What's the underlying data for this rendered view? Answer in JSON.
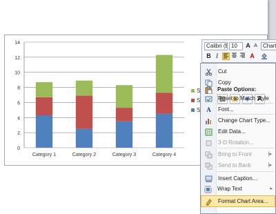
{
  "chart_data": {
    "type": "bar",
    "stacked": true,
    "categories": [
      "Category 1",
      "Category 2",
      "Category 3",
      "Category 4"
    ],
    "series": [
      {
        "name": "Seri",
        "values": [
          4.3,
          2.5,
          3.5,
          4.5
        ],
        "color": "#4f81bd"
      },
      {
        "name": "Seri",
        "values": [
          2.4,
          4.4,
          1.8,
          2.8
        ],
        "color": "#c0504d"
      },
      {
        "name": "Seri",
        "values": [
          2.0,
          2.0,
          3.0,
          5.0
        ],
        "color": "#9bbb59"
      }
    ],
    "ylim": [
      0,
      14
    ],
    "yticks": [
      "0",
      "2",
      "4",
      "6",
      "8",
      "10",
      "12",
      "14"
    ],
    "grid": true,
    "legend_position": "right",
    "legend_labels": [
      "Seri",
      "Seri",
      "Seri"
    ]
  },
  "minibar": {
    "font_name": "Calibri (E",
    "font_size": "10",
    "grow_font": "A",
    "shrink_font": "A",
    "chart_label": "Chart",
    "bold": "B",
    "italic": "I",
    "font_color": "A",
    "icons": [
      "align-left-icon",
      "align-center-icon",
      "align-right-icon",
      "font-color-icon",
      "fill-color-icon"
    ]
  },
  "context_menu": {
    "paste_options_label": "Paste Options:",
    "items": [
      {
        "label": "Cut",
        "icon": "cut-icon",
        "enabled": true
      },
      {
        "label": "Copy",
        "icon": "copy-icon",
        "enabled": true
      },
      {
        "label": "Reset to Match Style",
        "icon": "reset-style-icon",
        "enabled": true
      },
      {
        "label": "Font...",
        "icon": "font-icon",
        "enabled": true
      },
      {
        "label": "Change Chart Type...",
        "icon": "chart-type-icon",
        "enabled": true
      },
      {
        "label": "Edit Data...",
        "icon": "edit-data-icon",
        "enabled": true
      },
      {
        "label": "3-D Rotation...",
        "icon": "rotation-icon",
        "enabled": false
      },
      {
        "label": "Bring to Front",
        "icon": "bring-front-icon",
        "enabled": false
      },
      {
        "label": "Send to Back",
        "icon": "send-back-icon",
        "enabled": false
      },
      {
        "label": "Insert Caption...",
        "icon": "caption-icon",
        "enabled": true
      },
      {
        "label": "Wrap Text",
        "icon": "wrap-text-icon",
        "enabled": true
      },
      {
        "label": "Format Chart Area...",
        "icon": "format-area-icon",
        "enabled": true
      }
    ],
    "paste_buttons": [
      "paste-use-destination-icon",
      "paste-keep-source-icon",
      "paste-picture-icon",
      "paste-text-icon"
    ],
    "paste_text_glyph": "A",
    "font_glyph": "A"
  }
}
